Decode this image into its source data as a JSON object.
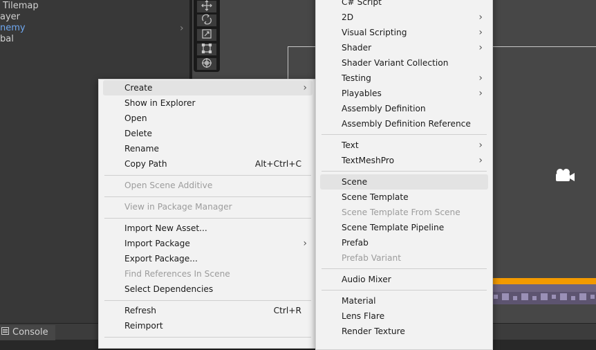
{
  "hierarchy": {
    "items": [
      {
        "label": "Tilemap",
        "selected": false
      },
      {
        "label": "ayer",
        "selected": false
      },
      {
        "label": "nemy",
        "selected": true
      },
      {
        "label": "bal",
        "selected": false
      }
    ],
    "chevron": "›"
  },
  "toolbar": {
    "tools": [
      "move-tool-icon",
      "rotate-tool-icon",
      "scale-tool-icon",
      "rect-tool-icon",
      "transform-tool-icon"
    ]
  },
  "console": {
    "icon": "console-icon",
    "label": "Console"
  },
  "context_menu": {
    "items": [
      {
        "label": "Create",
        "submenu": true,
        "highlighted": true
      },
      {
        "label": "Show in Explorer"
      },
      {
        "label": "Open"
      },
      {
        "label": "Delete"
      },
      {
        "label": "Rename"
      },
      {
        "label": "Copy Path",
        "shortcut": "Alt+Ctrl+C"
      },
      {
        "separator": true
      },
      {
        "label": "Open Scene Additive",
        "disabled": true
      },
      {
        "separator": true
      },
      {
        "label": "View in Package Manager",
        "disabled": true
      },
      {
        "separator": true
      },
      {
        "label": "Import New Asset..."
      },
      {
        "label": "Import Package",
        "submenu": true
      },
      {
        "label": "Export Package..."
      },
      {
        "label": "Find References In Scene",
        "disabled": true
      },
      {
        "label": "Select Dependencies"
      },
      {
        "separator": true
      },
      {
        "label": "Refresh",
        "shortcut": "Ctrl+R"
      },
      {
        "label": "Reimport"
      }
    ]
  },
  "create_submenu": {
    "items": [
      {
        "label": "C# Script"
      },
      {
        "label": "2D",
        "submenu": true
      },
      {
        "label": "Visual Scripting",
        "submenu": true
      },
      {
        "label": "Shader",
        "submenu": true
      },
      {
        "label": "Shader Variant Collection"
      },
      {
        "label": "Testing",
        "submenu": true
      },
      {
        "label": "Playables",
        "submenu": true
      },
      {
        "label": "Assembly Definition"
      },
      {
        "label": "Assembly Definition Reference"
      },
      {
        "separator": true
      },
      {
        "label": "Text",
        "submenu": true
      },
      {
        "label": "TextMeshPro",
        "submenu": true
      },
      {
        "separator": true
      },
      {
        "label": "Scene",
        "highlighted": true
      },
      {
        "label": "Scene Template"
      },
      {
        "label": "Scene Template From Scene",
        "disabled": true
      },
      {
        "label": "Scene Template Pipeline"
      },
      {
        "label": "Prefab"
      },
      {
        "label": "Prefab Variant",
        "disabled": true
      },
      {
        "separator": true
      },
      {
        "label": "Audio Mixer"
      },
      {
        "separator": true
      },
      {
        "label": "Material"
      },
      {
        "label": "Lens Flare"
      },
      {
        "label": "Render Texture"
      }
    ]
  },
  "colors": {
    "menu_bg": "#f2f2f2",
    "menu_highlight": "#e3e3e3",
    "disabled_text": "#9c9c9c",
    "selected_hierarchy_text": "#6fa8f0",
    "orange_strip": "#f39a00"
  }
}
